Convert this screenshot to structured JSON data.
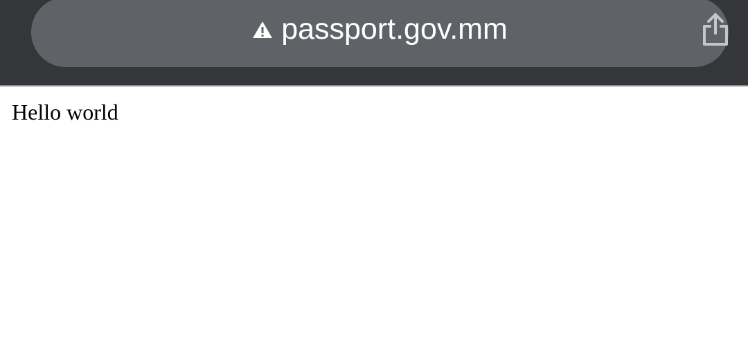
{
  "browser": {
    "address_bar": {
      "url": "passport.gov.mm",
      "security_icon": "warning-triangle-icon",
      "share_icon": "share-icon"
    },
    "colors": {
      "toolbar": "#35363a",
      "address_bar": "#5f6368",
      "url_text": "#ffffff"
    }
  },
  "page": {
    "body_text": "Hello world"
  }
}
